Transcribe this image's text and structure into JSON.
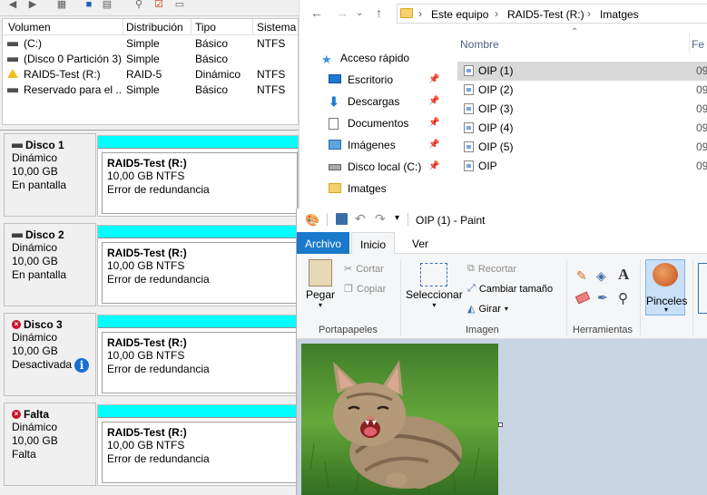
{
  "disk_management": {
    "columns": [
      "Volumen",
      "Distribución",
      "Tipo",
      "Sistema d"
    ],
    "volumes": [
      {
        "name": "(C:)",
        "layout": "Simple",
        "type": "Básico",
        "fs": "NTFS",
        "icon": "drive-icon"
      },
      {
        "name": "(Disco 0 Partición 3)",
        "layout": "Simple",
        "type": "Básico",
        "fs": "",
        "icon": "drive-icon"
      },
      {
        "name": "RAID5-Test (R:)",
        "layout": "RAID-5",
        "type": "Dinámico",
        "fs": "NTFS",
        "icon": "warning-icon"
      },
      {
        "name": "Reservado para el ...",
        "layout": "Simple",
        "type": "Básico",
        "fs": "NTFS",
        "icon": "drive-icon"
      }
    ],
    "disks": [
      {
        "name": "Disco 1",
        "kind": "Dinámico",
        "size": "10,00 GB",
        "state": "En pantalla",
        "error": false,
        "info": false,
        "part_name": "RAID5-Test  (R:)",
        "part_size": "10,00 GB NTFS",
        "part_status": "Error de redundancia"
      },
      {
        "name": "Disco 2",
        "kind": "Dinámico",
        "size": "10,00 GB",
        "state": "En pantalla",
        "error": false,
        "info": false,
        "part_name": "RAID5-Test  (R:)",
        "part_size": "10,00 GB NTFS",
        "part_status": "Error de redundancia"
      },
      {
        "name": "Disco 3",
        "kind": "Dinámico",
        "size": "10,00 GB",
        "state": "Desactivada",
        "error": true,
        "info": true,
        "part_name": "RAID5-Test  (R:)",
        "part_size": "10,00 GB NTFS",
        "part_status": "Error de redundancia"
      },
      {
        "name": "Falta",
        "kind": "Dinámico",
        "size": "10,00 GB",
        "state": "Falta",
        "error": true,
        "info": false,
        "part_name": "RAID5-Test  (R:)",
        "part_size": "10,00 GB NTFS",
        "part_status": "Error de redundancia"
      }
    ],
    "partition_color": "#00ffff"
  },
  "explorer": {
    "breadcrumb": [
      "Este equipo",
      "RAID5-Test (R:)",
      "Imatges"
    ],
    "sidebar": [
      {
        "label": "Acceso rápido",
        "icon": "star-icon",
        "pinned": false
      },
      {
        "label": "Escritorio",
        "icon": "desktop-icon",
        "pinned": true
      },
      {
        "label": "Descargas",
        "icon": "download-icon",
        "pinned": true
      },
      {
        "label": "Documentos",
        "icon": "documents-icon",
        "pinned": true
      },
      {
        "label": "Imágenes",
        "icon": "pictures-icon",
        "pinned": true
      },
      {
        "label": "Disco local (C:)",
        "icon": "drive-icon",
        "pinned": true
      },
      {
        "label": "Imatges",
        "icon": "folder-icon",
        "pinned": false
      }
    ],
    "col_name": "Nombre",
    "col_date": "Fe",
    "files": [
      {
        "name": "OIP (1)",
        "date": "09",
        "selected": true
      },
      {
        "name": "OIP (2)",
        "date": "09",
        "selected": false
      },
      {
        "name": "OIP (3)",
        "date": "09",
        "selected": false
      },
      {
        "name": "OIP (4)",
        "date": "09",
        "selected": false
      },
      {
        "name": "OIP (5)",
        "date": "09",
        "selected": false
      },
      {
        "name": "OIP",
        "date": "09",
        "selected": false
      }
    ]
  },
  "paint": {
    "title": "OIP (1) - Paint",
    "tabs": [
      "Archivo",
      "Inicio",
      "Ver"
    ],
    "clipboard": {
      "paste": "Pegar",
      "cut": "Cortar",
      "copy": "Copiar",
      "group": "Portapapeles"
    },
    "image": {
      "select": "Seleccionar",
      "crop": "Recortar",
      "resize": "Cambiar tamaño",
      "rotate": "Girar",
      "group": "Imagen"
    },
    "tools": {
      "group": "Herramientas"
    },
    "brushes": {
      "label": "Pinceles"
    },
    "accent": "#1979ca",
    "canvas_bg": "#c9d4e3"
  }
}
